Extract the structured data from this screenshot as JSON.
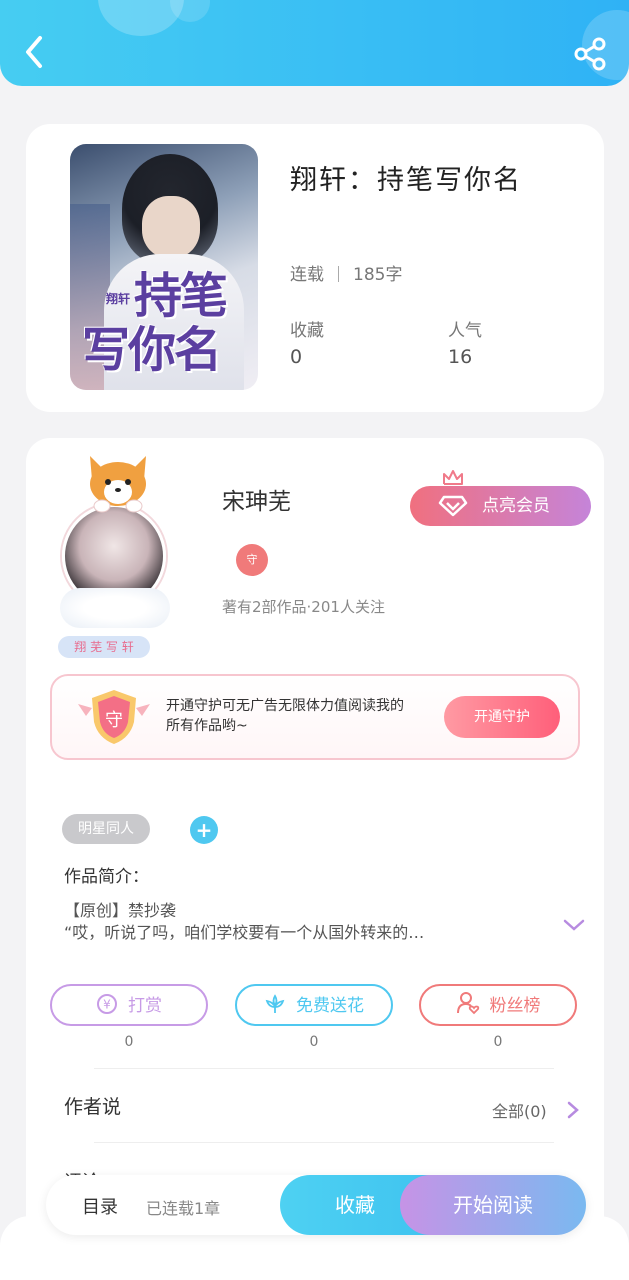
{
  "header": {
    "back_icon": "chevron-left-icon",
    "share_icon": "share-icon"
  },
  "book": {
    "cover_title_line1": "持笔",
    "cover_title_line2": "写你名",
    "cover_tag": "翔轩",
    "title": "翔轩：持笔写你名",
    "status": "连载",
    "word_count": "185字",
    "favorites_label": "收藏",
    "favorites_value": "0",
    "popularity_label": "人气",
    "popularity_value": "16"
  },
  "author": {
    "name": "宋珅芜",
    "ribbon": "翔 芜 写 轩",
    "badge": "守",
    "meta": "著有2部作品·201人关注",
    "vip_label": "点亮会员"
  },
  "guard": {
    "shield_char": "守",
    "text": "开通守护可无广告无限体力值阅读我的所有作品哟~",
    "button": "开通守护"
  },
  "tags": {
    "chip": "明星同人",
    "add": "+"
  },
  "intro": {
    "label": "作品简介：",
    "line1": "【原创】禁抄袭",
    "line2": "“哎，听说了吗，咱们学校要有一个从国外转来的…"
  },
  "actions": [
    {
      "label": "打赏",
      "count": "0",
      "color": "#c79be6",
      "icon": "yen-icon"
    },
    {
      "label": "免费送花",
      "count": "0",
      "color": "#4fc8f0",
      "icon": "flower-icon"
    },
    {
      "label": "粉丝榜",
      "count": "0",
      "color": "#f07a7a",
      "icon": "fan-icon"
    }
  ],
  "author_says": {
    "label": "作者说",
    "all_link": "全部(0)"
  },
  "peek_label": "评论",
  "bottom": {
    "toc": "目录",
    "serial": "已连载1章",
    "favorite": "收藏",
    "read": "开始阅读"
  }
}
